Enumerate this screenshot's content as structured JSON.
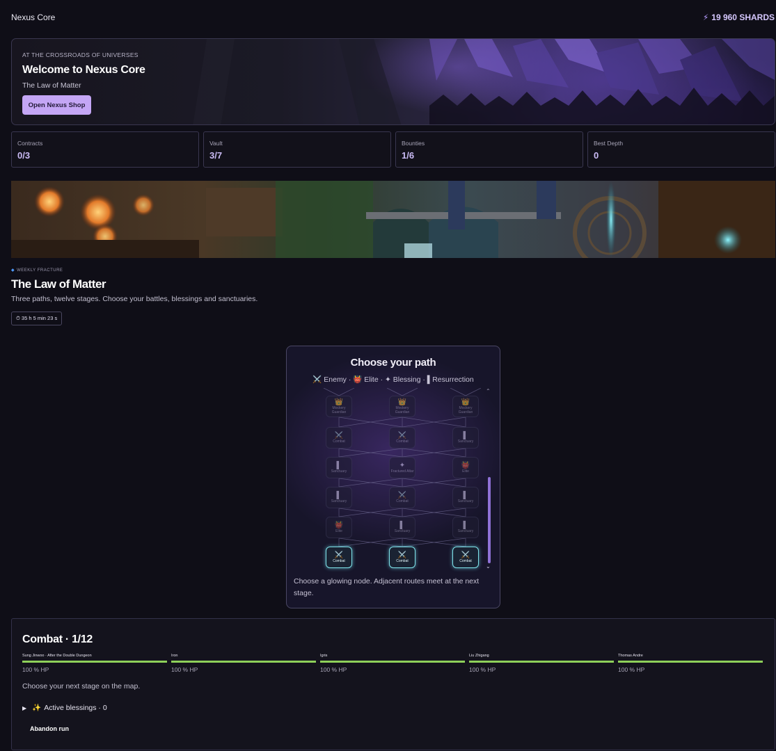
{
  "app": {
    "title": "Nexus Core",
    "currency": "19 960 SHARDS"
  },
  "hero": {
    "eyebrow": "AT THE CROSSROADS OF UNIVERSES",
    "title": "Welcome to Nexus Core",
    "subtitle": "The Law of Matter",
    "cta": "Open Nexus Shop"
  },
  "stats": [
    {
      "label": "Contracts",
      "value": "0/3"
    },
    {
      "label": "Vault",
      "value": "3/7"
    },
    {
      "label": "Bounties",
      "value": "1/6"
    },
    {
      "label": "Best Depth",
      "value": "0"
    }
  ],
  "fracture": {
    "eyebrow": "WEEKLY FRACTURE",
    "title": "The Law of Matter",
    "description": "Three paths, twelve stages. Choose your battles, blessings and sanctuaries.",
    "timer": "⏱ 35 h 5 min 23 s"
  },
  "map": {
    "title": "Choose your path",
    "legend": "⚔️ Enemy · 👹 Elite · ✦ Blessing · ▌Resurrection",
    "hint": "Choose a glowing node. Adjacent routes meet at the next stage.",
    "rows": [
      [
        {
          "icon": "👑",
          "label": "Mockery Guardian"
        },
        {
          "icon": "👑",
          "label": "Mockery Guardian"
        },
        {
          "icon": "👑",
          "label": "Mockery Guardian"
        }
      ],
      [
        {
          "icon": "⚔️",
          "label": "Combat"
        },
        {
          "icon": "⚔️",
          "label": "Combat"
        },
        {
          "icon": "▌",
          "label": "Sanctuary"
        }
      ],
      [
        {
          "icon": "▌",
          "label": "Sanctuary"
        },
        {
          "icon": "✦",
          "label": "Fractured Altar"
        },
        {
          "icon": "👹",
          "label": "Elite"
        }
      ],
      [
        {
          "icon": "▌",
          "label": "Sanctuary"
        },
        {
          "icon": "⚔️",
          "label": "Combat"
        },
        {
          "icon": "▌",
          "label": "Sanctuary"
        }
      ],
      [
        {
          "icon": "👹",
          "label": "Elite"
        },
        {
          "icon": "▌",
          "label": "Sanctuary"
        },
        {
          "icon": "▌",
          "label": "Sanctuary"
        }
      ],
      [
        {
          "icon": "⚔️",
          "label": "Combat",
          "active": true
        },
        {
          "icon": "⚔️",
          "label": "Combat",
          "active": true
        },
        {
          "icon": "⚔️",
          "label": "Combat",
          "active": true
        }
      ]
    ]
  },
  "run": {
    "title": "Combat · 1/12",
    "party": [
      {
        "name": "Sung Jinwoo · After the Double Dungeon",
        "hp": "100 % HP",
        "hp_fraction": 1
      },
      {
        "name": "Iron",
        "hp": "100 % HP",
        "hp_fraction": 1
      },
      {
        "name": "Igris",
        "hp": "100 % HP",
        "hp_fraction": 1
      },
      {
        "name": "Liu Zhigang",
        "hp": "100 % HP",
        "hp_fraction": 1
      },
      {
        "name": "Thomas Andre",
        "hp": "100 % HP",
        "hp_fraction": 1
      }
    ],
    "hint": "Choose your next stage on the map.",
    "blessings": "Active blessings · 0",
    "abandon": "Abandon run"
  },
  "colors": {
    "accent": "#c4a6f5",
    "hp_bar": "#8ed05a",
    "active_node": "#7fe3ea"
  }
}
